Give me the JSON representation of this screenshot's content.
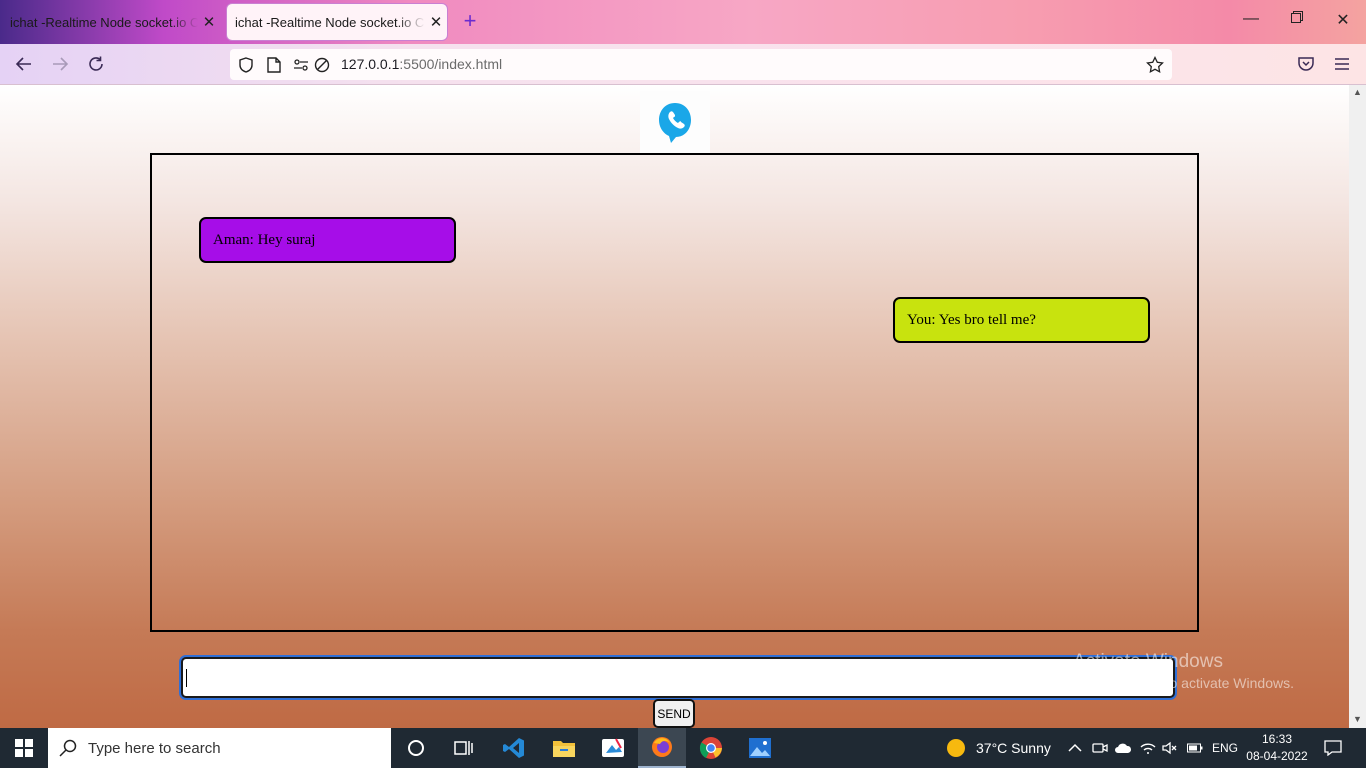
{
  "browser": {
    "tabs": [
      {
        "title": "ichat -Realtime Node socket.io Chat",
        "active": false
      },
      {
        "title": "ichat -Realtime Node socket.io Chat",
        "active": true
      }
    ],
    "url_host": "127.0.0.1",
    "url_path": ":5500/index.html"
  },
  "chat": {
    "messages": [
      {
        "text": "Aman: Hey suraj",
        "position": "left",
        "color": "#a60de8"
      },
      {
        "text": "You: Yes bro tell me?",
        "position": "right",
        "color": "#c8e30e"
      }
    ],
    "input_value": "",
    "send_label": "SEND"
  },
  "watermark": {
    "line1": "Activate Windows",
    "line2": "Go to Settings to activate Windows."
  },
  "taskbar": {
    "search_placeholder": "Type here to search",
    "weather": "37°C  Sunny",
    "language": "ENG",
    "time": "16:33",
    "date": "08-04-2022"
  }
}
